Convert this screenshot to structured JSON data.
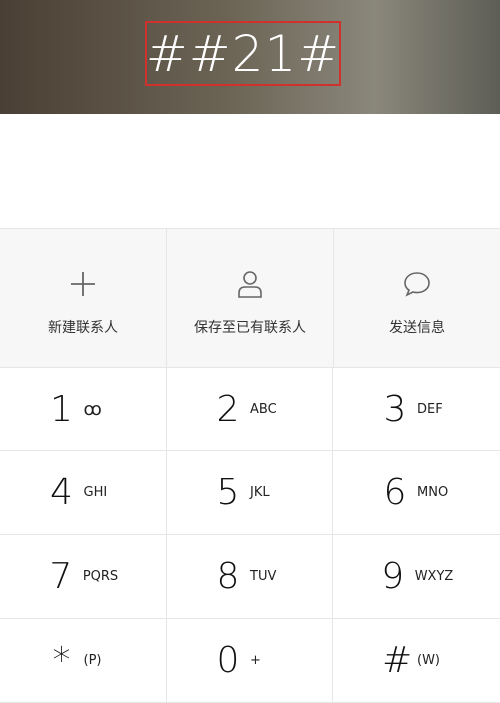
{
  "dialed_number": "##21#",
  "actions": [
    {
      "label": "新建联系人",
      "icon": "plus-icon"
    },
    {
      "label": "保存至已有联系人",
      "icon": "person-icon"
    },
    {
      "label": "发送信息",
      "icon": "chat-bubble-icon"
    }
  ],
  "keys": [
    {
      "digit": "1",
      "letters": "ꝏ",
      "icon": "voicemail-icon"
    },
    {
      "digit": "2",
      "letters": "ABC"
    },
    {
      "digit": "3",
      "letters": "DEF"
    },
    {
      "digit": "4",
      "letters": "GHI"
    },
    {
      "digit": "5",
      "letters": "JKL"
    },
    {
      "digit": "6",
      "letters": "MNO"
    },
    {
      "digit": "7",
      "letters": "PQRS"
    },
    {
      "digit": "8",
      "letters": "TUV"
    },
    {
      "digit": "9",
      "letters": "WXYZ"
    },
    {
      "digit": "*",
      "letters": "(P)"
    },
    {
      "digit": "0",
      "letters": "+"
    },
    {
      "digit": "#",
      "letters": "(W)"
    }
  ],
  "colors": {
    "highlight_border": "#d0312d",
    "divider": "#e6e6e6",
    "actions_bg": "#f7f7f7"
  }
}
